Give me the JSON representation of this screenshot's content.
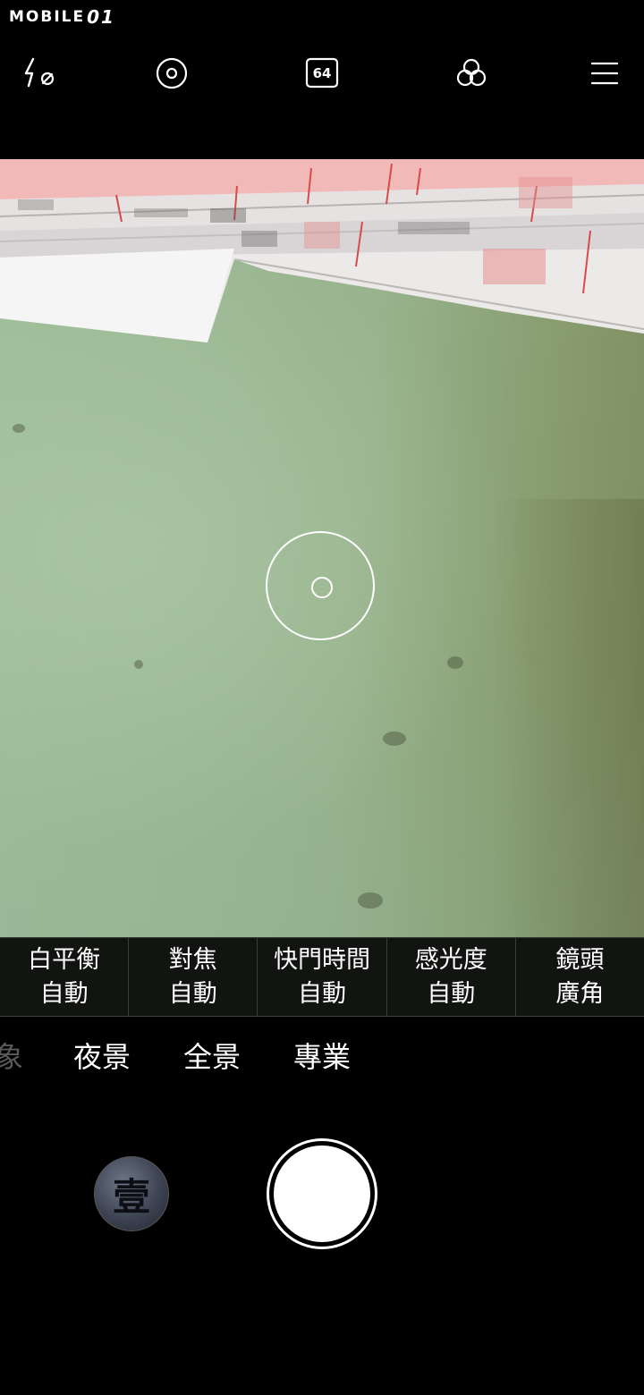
{
  "watermark": {
    "text": "MOBILE",
    "suffix": "01"
  },
  "top_bar": {
    "icons": [
      "flash-off-icon",
      "live-photo-icon",
      "resolution-64mp-icon",
      "filter-icon",
      "menu-icon"
    ],
    "resolution_label": "64"
  },
  "pro_settings": {
    "items": [
      {
        "name": "白平衡",
        "value": "自動"
      },
      {
        "name": "對焦",
        "value": "自動"
      },
      {
        "name": "快門時間",
        "value": "自動"
      },
      {
        "name": "感光度",
        "value": "自動"
      },
      {
        "name": "鏡頭",
        "value": "廣角"
      }
    ]
  },
  "modes": {
    "items": [
      "象",
      "夜景",
      "全景",
      "專業"
    ]
  },
  "gallery": {
    "thumb_text": "壹"
  },
  "colors": {
    "accent": "#ffffff",
    "background": "#000000",
    "faded_mode": "#5a5a5a"
  }
}
